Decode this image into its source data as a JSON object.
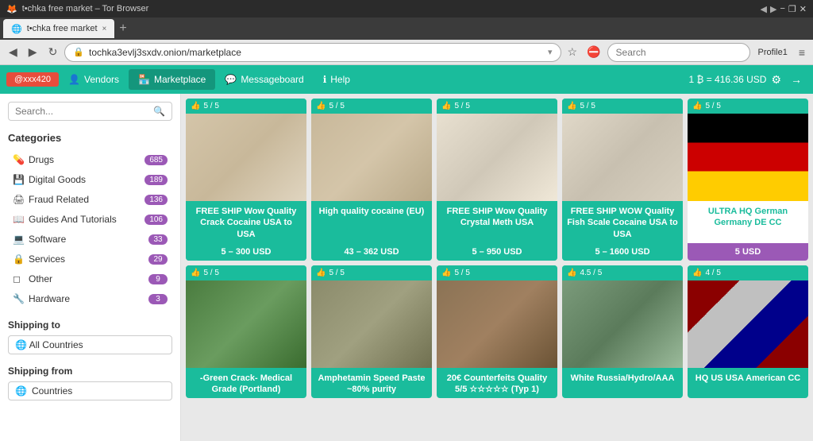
{
  "window": {
    "title": "t•chka free market – Tor Browser"
  },
  "tab": {
    "label": "t•chka free market",
    "close": "×"
  },
  "nav": {
    "url": "tochka3evlj3sxdv.onion/marketplace",
    "search_placeholder": "Search"
  },
  "site_nav": {
    "user": "@xxx420",
    "vendors": "Vendors",
    "marketplace": "Marketplace",
    "messageboard": "Messageboard",
    "help": "Help",
    "btc": "1 ₿  = 416.36 USD",
    "profile": "Profile1"
  },
  "sidebar": {
    "search_placeholder": "Search...",
    "categories_title": "Categories",
    "categories": [
      {
        "icon": "💊",
        "label": "Drugs",
        "count": "685"
      },
      {
        "icon": "💾",
        "label": "Digital Goods",
        "count": "189"
      },
      {
        "icon": "🖨",
        "label": "Fraud Related",
        "count": "136"
      },
      {
        "icon": "📖",
        "label": "Guides And Tutorials",
        "count": "106"
      },
      {
        "icon": "💻",
        "label": "Software",
        "count": "33"
      },
      {
        "icon": "🔒",
        "label": "Services",
        "count": "29"
      },
      {
        "icon": "◻",
        "label": "Other",
        "count": "9"
      },
      {
        "icon": "🔧",
        "label": "Hardware",
        "count": "3"
      }
    ],
    "shipping_to_title": "Shipping to",
    "shipping_to_value": "🌐  All Countries",
    "shipping_from_title": "Shipping from",
    "countries_label": "Countries"
  },
  "products": [
    {
      "rating": "5 / 5",
      "title": "FREE SHIP Wow Quality Crack Cocaine USA to USA",
      "price": "5 – 300 USD",
      "img_class": "img-crack",
      "card_bg": "teal"
    },
    {
      "rating": "5 / 5",
      "title": "High quality cocaine (EU)",
      "price": "43 – 362 USD",
      "img_class": "img-cocaine",
      "card_bg": "teal"
    },
    {
      "rating": "5 / 5",
      "title": "FREE SHIP Wow Quality Crystal Meth USA",
      "price": "5 – 950 USD",
      "img_class": "img-meth",
      "card_bg": "teal"
    },
    {
      "rating": "5 / 5",
      "title": "FREE SHIP WOW Quality Fish Scale Cocaine USA to USA",
      "price": "5 – 1600 USD",
      "img_class": "img-fish",
      "card_bg": "teal"
    },
    {
      "rating": "5 / 5",
      "title": "ULTRA HQ German Germany DE CC",
      "price": "5 USD",
      "img_class": "img-german",
      "card_bg": "white",
      "price_bg": "purple"
    },
    {
      "rating": "5 / 5",
      "title": "-Green Crack- Medical Grade (Portland)",
      "price": "",
      "img_class": "img-weed",
      "card_bg": "teal"
    },
    {
      "rating": "5 / 5",
      "title": "Amphetamin Speed Paste ~80% purity",
      "price": "",
      "img_class": "img-amp",
      "card_bg": "teal"
    },
    {
      "rating": "5 / 5",
      "title": "20€ Counterfeits Quality 5/5 ☆☆☆☆☆ (Typ 1)",
      "price": "",
      "img_class": "img-counter",
      "card_bg": "teal"
    },
    {
      "rating": "4.5 / 5",
      "title": "White Russia/Hydro/AAA",
      "price": "",
      "img_class": "img-russia",
      "card_bg": "teal"
    },
    {
      "rating": "4 / 5",
      "title": "HQ US USA American CC",
      "price": "",
      "img_class": "img-usa",
      "card_bg": "teal"
    }
  ]
}
